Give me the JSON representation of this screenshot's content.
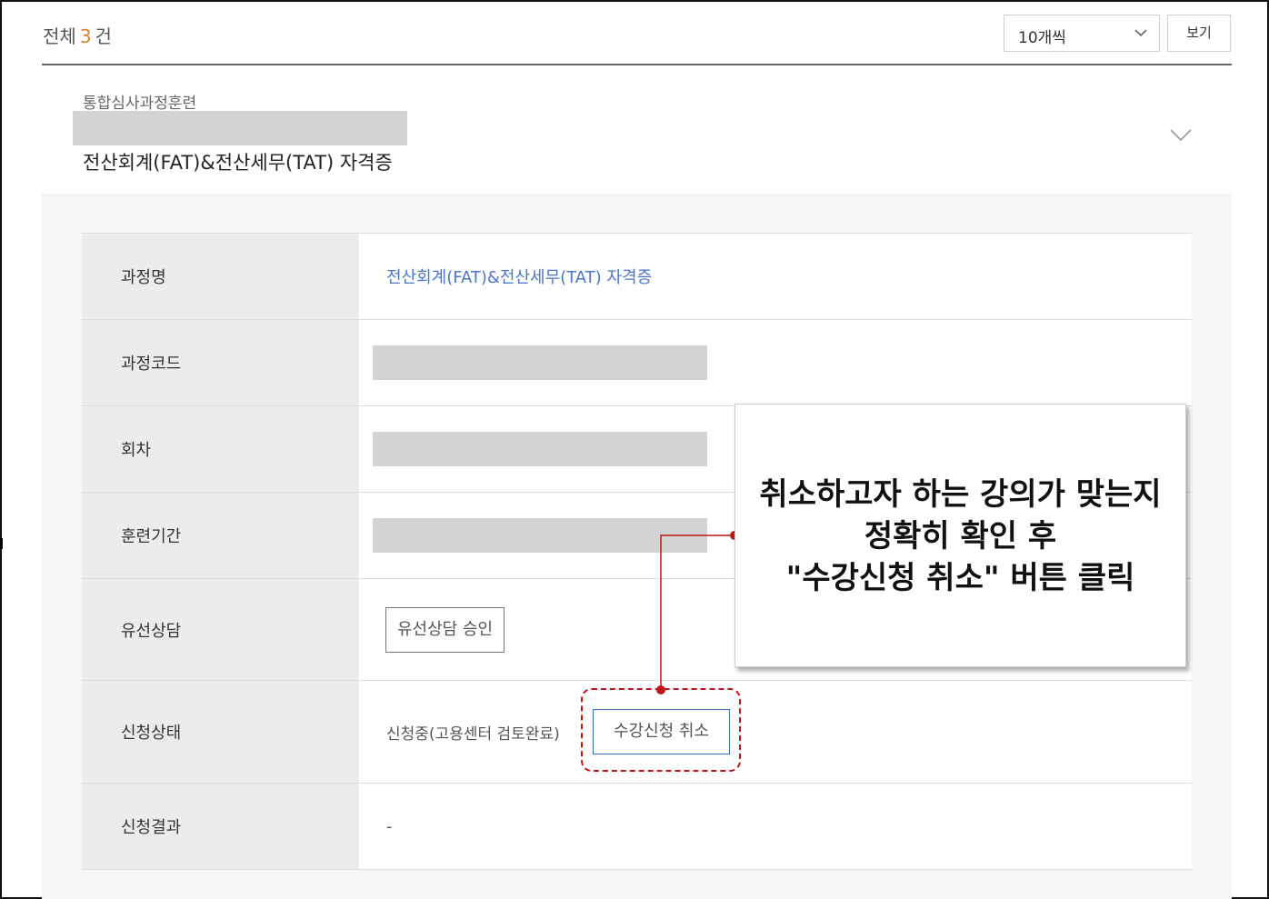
{
  "header": {
    "total_prefix": "전체",
    "total_count": "3",
    "total_suffix": "건",
    "page_size_selected": "10개씩",
    "view_button": "보기"
  },
  "course": {
    "category": "통합심사과정훈련",
    "title": "전산회계(FAT)&전산세무(TAT) 자격증"
  },
  "details": {
    "rows": [
      {
        "label": "과정명",
        "value": "전산회계(FAT)&전산세무(TAT) 자격증"
      },
      {
        "label": "과정코드"
      },
      {
        "label": "회차"
      },
      {
        "label": "훈련기간"
      },
      {
        "label": "유선상담",
        "button": "유선상담 승인"
      },
      {
        "label": "신청상태",
        "value": "신청중(고용센터 검토완료)",
        "button": "수강신청 취소"
      },
      {
        "label": "신청결과",
        "value": "-"
      }
    ]
  },
  "callout": {
    "lines": [
      "취소하고자 하는 강의가 맞는지",
      "정확히 확인 후",
      "\"수강신청 취소\" 버튼 클릭"
    ]
  },
  "colors": {
    "accent_orange": "#d9822b",
    "link_blue": "#4a76c9",
    "cancel_border": "#3d6fc7",
    "annotation_red": "#c0141b"
  }
}
